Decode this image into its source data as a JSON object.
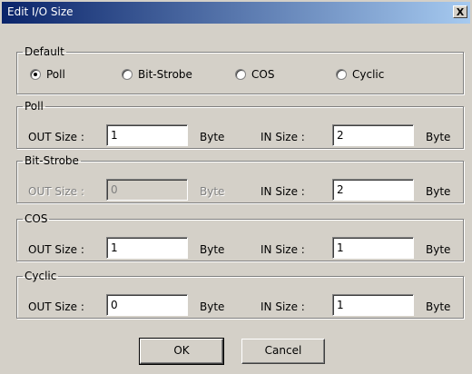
{
  "window": {
    "title": "Edit I/O Size",
    "close_glyph": "X"
  },
  "default_group": {
    "legend": "Default",
    "options": [
      {
        "label": "Poll",
        "checked": true
      },
      {
        "label": "Bit-Strobe",
        "checked": false
      },
      {
        "label": "COS",
        "checked": false
      },
      {
        "label": "Cyclic",
        "checked": false
      }
    ]
  },
  "poll": {
    "legend": "Poll",
    "out_label": "OUT Size :",
    "out_value": "1",
    "out_unit": "Byte",
    "in_label": "IN Size :",
    "in_value": "2",
    "in_unit": "Byte"
  },
  "bit_strobe": {
    "legend": "Bit-Strobe",
    "out_label": "OUT Size :",
    "out_value": "0",
    "out_unit": "Byte",
    "in_label": "IN Size :",
    "in_value": "2",
    "in_unit": "Byte",
    "out_disabled": true
  },
  "cos": {
    "legend": "COS",
    "out_label": "OUT Size :",
    "out_value": "1",
    "out_unit": "Byte",
    "in_label": "IN Size :",
    "in_value": "1",
    "in_unit": "Byte"
  },
  "cyclic": {
    "legend": "Cyclic",
    "out_label": "OUT Size :",
    "out_value": "0",
    "out_unit": "Byte",
    "in_label": "IN Size :",
    "in_value": "1",
    "in_unit": "Byte"
  },
  "buttons": {
    "ok": "OK",
    "cancel": "Cancel"
  }
}
